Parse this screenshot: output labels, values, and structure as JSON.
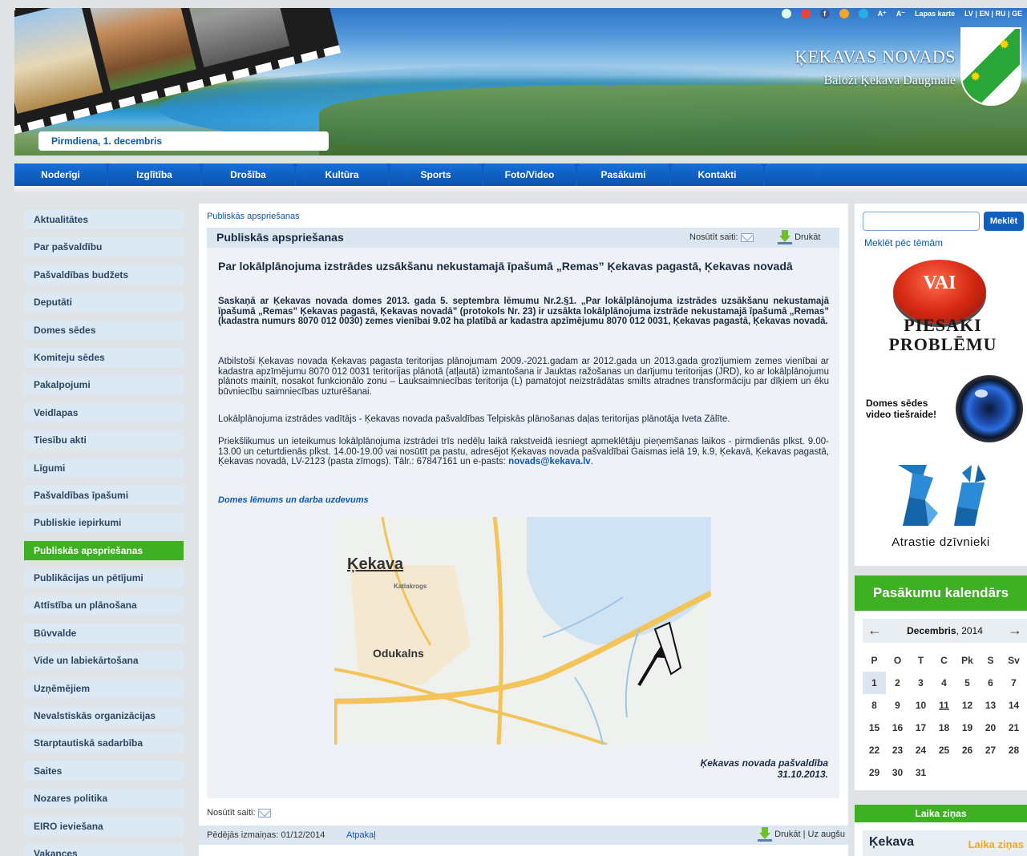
{
  "header": {
    "site_name": "ĶEKAVAS NOVADS",
    "site_sub": "Baloži  Ķekava  Daugmale",
    "date": "Pirmdiena, 1. decembris",
    "topbar": {
      "font_larger": "A⁺",
      "font_smaller": "A⁻",
      "sitemap": "Lapas karte",
      "langs": "LV | EN | RU | GE"
    }
  },
  "nav": [
    "Noderīgi",
    "Izglītība",
    "Drošība",
    "Kultūra",
    "Sports",
    "Foto/Video",
    "Pasākumi",
    "Kontakti"
  ],
  "sidebar": {
    "items": [
      "Aktualitātes",
      "Par pašvaldību",
      "Pašvaldības budžets",
      "Deputāti",
      "Domes sēdes",
      "Komiteju sēdes",
      "Pakalpojumi",
      "Veidlapas",
      "Tiesību akti",
      "Līgumi",
      "Pašvaldības īpašumi",
      "Publiskie iepirkumi",
      "Publiskās apspriešanas",
      "Publikācijas un pētījumi",
      "Attīstība un plānošana",
      "Būvvalde",
      "Vide un labiekārtošana",
      "Uzņēmējiem",
      "Nevalstiskās organizācijas",
      "Starptautiskā sadarbība",
      "Saites",
      "Nozares politika",
      "EIRO ieviešana",
      "Vakances"
    ],
    "active_index": 12
  },
  "main": {
    "breadcrumb": "Publiskās apspriešanas",
    "title": "Publiskās apspriešanas",
    "send_link": "Nosūtīt saiti:",
    "print": "Drukāt",
    "article_title": "Par lokālplānojuma izstrādes uzsākšanu nekustamajā īpašumā „Remas” Ķekavas pagastā, Ķekavas novadā",
    "intro": "Saskaņā ar Ķekavas novada domes 2013. gada 5. septembra lēmumu Nr.2.§1. „Par lokālplānojuma izstrādes uzsākšanu nekustamajā īpašumā „Remas” Ķekavas pagastā, Ķekavas novadā”  (protokols Nr. 23) ir uzsākta lokālplānojuma izstrāde nekustamajā īpašumā „Remas” (kadastra numurs 8070 012 0030) zemes vienībai 9.02 ha platībā ar kadastra apzīmējumu 8070 012 0031, Ķekavas pagastā, Ķekavas novadā.",
    "p1": "Atbilstoši Ķekavas novada Ķekavas pagasta teritorijas plānojumam 2009.-2021.gadam ar 2012.gada un 2013.gada grozījumiem zemes vienībai ar kadastra apzīmējumu 8070 012 0031 teritorijas plānotā (atļautā) izmantošana ir Jauktas ražošanas un darījumu teritorijas (JRD), ko ar lokālplānojumu plānots mainīt, nosakot funkcionālo zonu – Lauksaimniecības teritorija (L) pamatojot neizstrādātas smilts atradnes transformāciju par dīķiem un ēku būvniecību saimniecības uzturēšanai.",
    "p2": "Lokālplānojuma izstrādes vadītājs - Ķekavas novada pašvaldības Telpiskās plānošanas daļas teritorijas plānotāja Iveta Zālīte.",
    "p3": "Priekšlikumus un ieteikumus lokālplānojuma izstrādei trīs nedēļu laikā rakstveidā iesniegt apmeklētāju pieņemšanas laikos - pirmdienās plkst. 9.00-13.00 un ceturtdienās plkst. 14.00-19.00 vai nosūtīt pa pastu, adresējot Ķekavas novada pašvaldībai Gaismas ielā 19, k.9, Ķekavā, Ķekavas pagastā, Ķekavas novadā, LV-2123 (pasta zīmogs). Tālr.: 67847161 un e-pasts: ",
    "email": "novads@kekava.lv",
    "doc_link": "Domes lēmums un darba uzdevums",
    "map": {
      "label_kekava": "Ķekava",
      "label_odukalns": "Odukalns",
      "label_katlakrogs": "Katlakrogs"
    },
    "sign_1": "Ķekavas novada pašvaldība",
    "sign_2": "31.10.2013.",
    "bottom_send": "Nosūtīt saiti:",
    "footer_modified": "Pēdējās izmaiņas: 01/12/2014",
    "footer_back": "Atpakaļ",
    "footer_print": "Drukāt | Uz augšu"
  },
  "right": {
    "search_placeholder": "",
    "search_btn": "Meklēt",
    "search_topics": "Meklēt pēc tēmām",
    "problem_vai": "VAI",
    "problem_line1": "PIESAKI",
    "problem_line2": "PROBLĒMU",
    "video_line1": "Domes sēdes",
    "video_line2": "video tiešraide!",
    "pets": "Atrastie dzīvnieki",
    "calendar": {
      "title": "Pasākumu kalendārs",
      "month": "Decembris",
      "year": ", 2014",
      "weekdays": [
        "P",
        "O",
        "T",
        "C",
        "Pk",
        "S",
        "Sv"
      ],
      "weeks": [
        [
          "1",
          "2",
          "3",
          "4",
          "5",
          "6",
          "7"
        ],
        [
          "8",
          "9",
          "10",
          "11",
          "12",
          "13",
          "14"
        ],
        [
          "15",
          "16",
          "17",
          "18",
          "19",
          "20",
          "21"
        ],
        [
          "22",
          "23",
          "24",
          "25",
          "26",
          "27",
          "28"
        ],
        [
          "29",
          "30",
          "31",
          "",
          "",
          "",
          ""
        ]
      ]
    },
    "weather_title": "Laika ziņas",
    "weather_city": "Ķekava",
    "weather_logo_a": "Laika",
    "weather_logo_b": "ziņas"
  }
}
